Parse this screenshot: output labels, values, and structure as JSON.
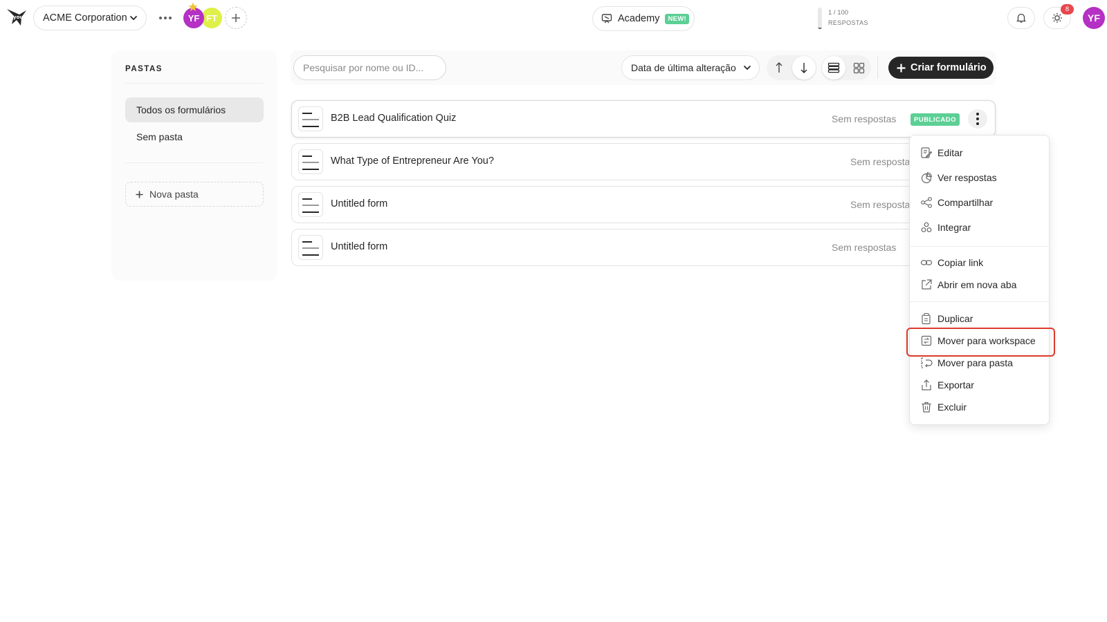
{
  "header": {
    "workspace_name": "ACME Corporation",
    "members": [
      {
        "initials": "YF",
        "color": "#b530c4"
      },
      {
        "initials": "FT",
        "color": "#dff04a"
      }
    ],
    "academy_label": "Academy",
    "academy_badge": "NEW!",
    "usage": {
      "count_text": "1 / 100",
      "label": "RESPOSTAS",
      "used": 1,
      "limit": 100
    },
    "notification_count": "8",
    "user_initials": "YF",
    "user_color": "#b530c4"
  },
  "sidebar": {
    "title": "PASTAS",
    "items": [
      {
        "label": "Todos os formulários",
        "active": true
      },
      {
        "label": "Sem pasta",
        "active": false
      }
    ],
    "new_folder_label": "Nova pasta"
  },
  "toolbar": {
    "search_placeholder": "Pesquisar por nome ou ID...",
    "sort_label": "Data de última alteração",
    "create_label": "Criar formulário"
  },
  "forms": [
    {
      "name": "B2B Lead Qualification Quiz",
      "responses": "Sem respostas",
      "status": "PUBLICADO"
    },
    {
      "name": "What Type of Entrepreneur Are You?",
      "responses": "Sem respostas",
      "status": ""
    },
    {
      "name": "Untitled form",
      "responses": "Sem respostas",
      "status": ""
    },
    {
      "name": "Untitled form",
      "responses": "Sem respostas",
      "status": ""
    }
  ],
  "context_menu": {
    "items": [
      {
        "label": "Editar",
        "icon": "edit-icon"
      },
      {
        "label": "Ver respostas",
        "icon": "pie-chart-icon"
      },
      {
        "label": "Compartilhar",
        "icon": "share-icon"
      },
      {
        "label": "Integrar",
        "icon": "integrate-icon"
      },
      {
        "label": "Copiar link",
        "icon": "link-icon"
      },
      {
        "label": "Abrir em nova aba",
        "icon": "external-link-icon"
      },
      {
        "label": "Duplicar",
        "icon": "duplicate-icon"
      },
      {
        "label": "Mover para workspace",
        "icon": "move-workspace-icon"
      },
      {
        "label": "Mover para pasta",
        "icon": "move-folder-icon"
      },
      {
        "label": "Exportar",
        "icon": "export-icon"
      },
      {
        "label": "Excluir",
        "icon": "trash-icon"
      }
    ],
    "highlighted_item": "Mover para workspace"
  },
  "colors": {
    "accent_dark": "#262627",
    "published_green": "#5ccf95",
    "highlight_red": "#dc3a2a",
    "notification_red": "#e5484d"
  }
}
